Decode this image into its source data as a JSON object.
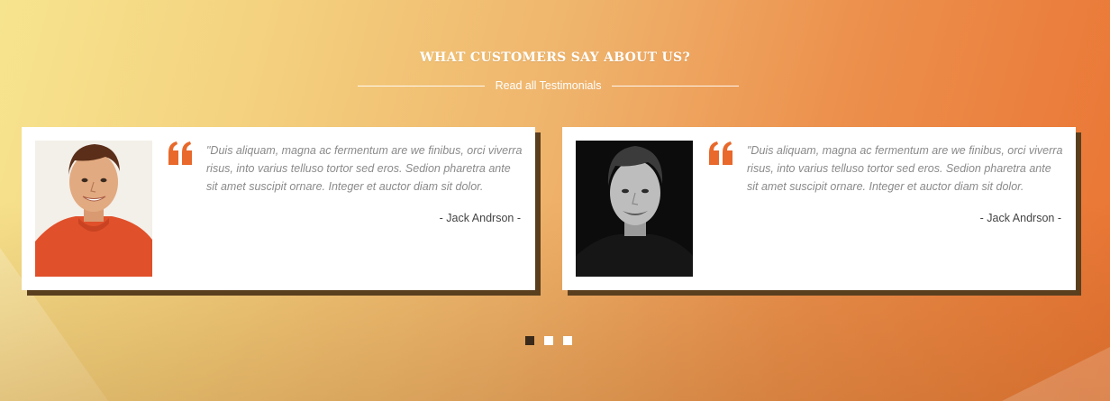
{
  "section": {
    "heading": "WHAT CUSTOMERS SAY ABOUT US?",
    "link_label": "Read all Testimonials"
  },
  "testimonials": [
    {
      "quote": "\"Duis aliquam, magna ac fermentum are we finibus, orci viverra risus, into varius telluso tortor sed eros. Sedion pharetra ante sit amet suscipit ornare. Integer et auctor diam sit dolor.",
      "author": "- Jack Andrson -",
      "photo": "man-red-shirt-photo"
    },
    {
      "quote": "\"Duis aliquam, magna ac fermentum are we finibus, orci viverra risus, into varius telluso tortor sed eros. Sedion pharetra ante sit amet suscipit ornare. Integer et auctor diam sit dolor.",
      "author": "- Jack Andrson -",
      "photo": "man-bw-photo"
    }
  ],
  "pagination": {
    "count": 3,
    "active": 1
  },
  "colors": {
    "accent": "#e8692b",
    "card_shadow": "#5a3f1f",
    "dot_active": "#3b2a1a",
    "dot_inactive": "#ffffff"
  },
  "icons": {
    "quote": "quote-icon"
  }
}
